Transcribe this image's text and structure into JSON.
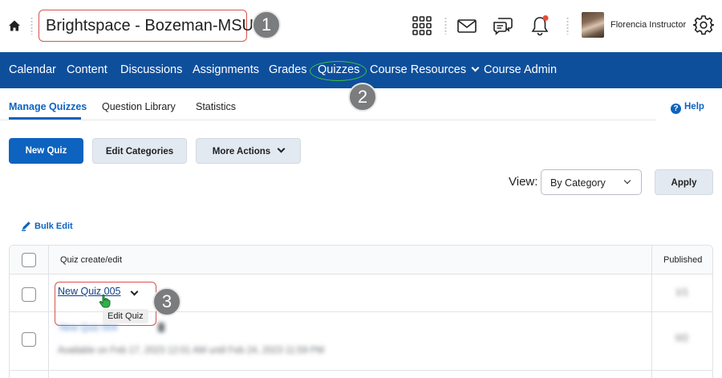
{
  "header": {
    "org_title": "Brightspace - Bozeman-MSU",
    "user_name": "Florencia Instructor",
    "icons": [
      "home-icon",
      "waffle-grid-icon",
      "mail-icon",
      "chat-icon",
      "bell-icon",
      "gear-icon"
    ],
    "notification_color": "#e94b35"
  },
  "callouts": [
    "1",
    "2",
    "3"
  ],
  "nav": {
    "items": [
      "Calendar",
      "Content",
      "Discussions",
      "Assignments",
      "Grades",
      "Quizzes",
      "Course Resources",
      "Course Admin"
    ],
    "background": "#0e4f9c"
  },
  "tabs": {
    "items": [
      "Manage Quizzes",
      "Question Library",
      "Statistics"
    ],
    "active": "Manage Quizzes",
    "help": "Help"
  },
  "toolbar": {
    "new_quiz": "New Quiz",
    "edit_categories": "Edit Categories",
    "more_actions": "More Actions"
  },
  "view": {
    "label": "View:",
    "selected": "By Category",
    "apply": "Apply"
  },
  "bulk_edit": "Bulk Edit",
  "table": {
    "headers": [
      "Quiz create/edit",
      "Published"
    ],
    "rows": [
      {
        "name": "New Quiz 005",
        "tooltip": "Edit Quiz",
        "published": "1/1"
      },
      {
        "name": "New Quiz 004",
        "availability": "Available on Feb 17, 2023 12:01 AM until Feb 24, 2023 11:59 PM",
        "published": "0/2"
      }
    ]
  },
  "accent_color": "#0d63bf"
}
